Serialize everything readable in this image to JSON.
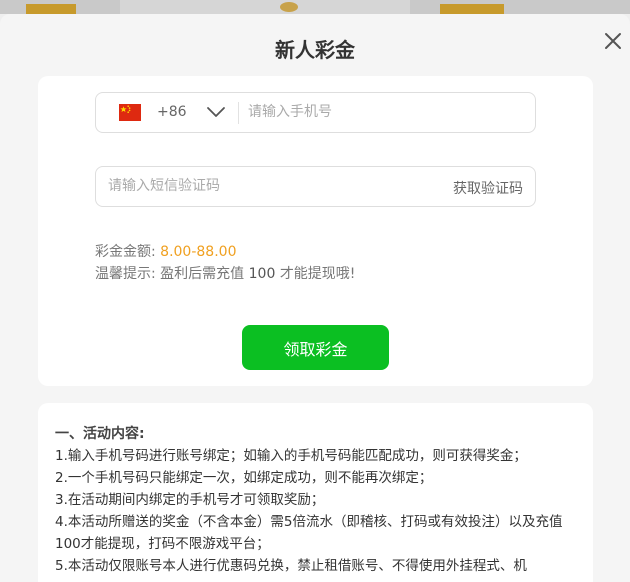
{
  "modal": {
    "title": "新人彩金",
    "close_icon": "close-icon"
  },
  "phone": {
    "country_flag": "china-flag-icon",
    "dial_code": "+86",
    "dropdown_icon": "chevron-down-icon",
    "placeholder": "请输入手机号",
    "value": ""
  },
  "sms": {
    "placeholder": "请输入短信验证码",
    "value": "",
    "get_code_label": "获取验证码"
  },
  "bonus": {
    "amount_label": "彩金金额:",
    "amount_value": "8.00-88.00",
    "tip_prefix": "温馨提示: 盈利后需充值",
    "tip_amount": "100",
    "tip_suffix": "才能提现哦!"
  },
  "claim_button_label": "领取彩金",
  "rules": {
    "title": "一、活动内容:",
    "items": [
      "1.输入手机号码进行账号绑定；如输入的手机号码能匹配成功，则可获得奖金；",
      "2.一个手机号码只能绑定一次，如绑定成功，则不能再次绑定；",
      "3.在活动期间内绑定的手机号才可领取奖励；",
      "4.本活动所赠送的奖金（不含本金）需5倍流水（即稽核、打码或有效投注）以及充值100才能提现，打码不限游戏平台；",
      "5.本活动仅限账号本人进行优惠码兑换，禁止租借账号、不得使用外挂程式、机"
    ]
  },
  "colors": {
    "accent_green": "#0bbf22",
    "amount_orange": "#f0a020"
  }
}
